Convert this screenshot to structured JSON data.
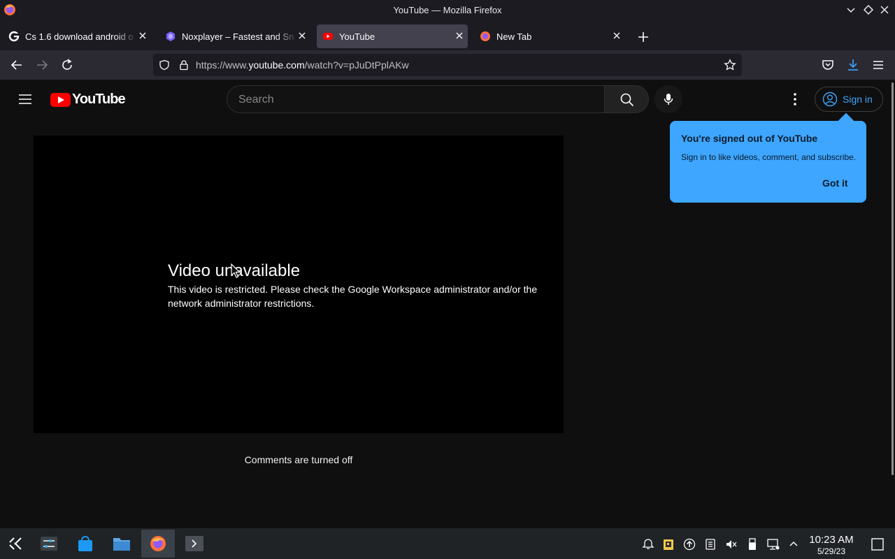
{
  "window": {
    "title": "YouTube — Mozilla Firefox"
  },
  "tabs": [
    {
      "label": "Cs 1.6 download android o",
      "icon": "google-g-icon",
      "active": false
    },
    {
      "label": "Noxplayer – Fastest and Sn",
      "icon": "noxplayer-icon",
      "active": false
    },
    {
      "label": "YouTube",
      "icon": "youtube-icon",
      "active": true
    },
    {
      "label": "New Tab",
      "icon": "firefox-icon",
      "active": false
    }
  ],
  "urlbar": {
    "prefix": "https://www.",
    "domain": "youtube.com",
    "path": "/watch?v=pJuDtPplAKw"
  },
  "youtube": {
    "logo_text": "YouTube",
    "search_placeholder": "Search",
    "signin_label": "Sign in"
  },
  "popup": {
    "heading": "You're signed out of YouTube",
    "body": "Sign in to like videos, comment, and subscribe.",
    "button": "Got it"
  },
  "player": {
    "heading": "Video unavailable",
    "message": "This video is restricted. Please check the Google Workspace administrator and/or the network administrator restrictions."
  },
  "comments": {
    "status": "Comments are turned off"
  },
  "taskbar": {
    "clock_time": "10:23 AM",
    "clock_date": "5/29/23"
  },
  "colors": {
    "youtube_red": "#ff0000",
    "accent_blue": "#3ea6ff",
    "page_bg": "#0f0f0f",
    "firefox_toolbar": "#2b2a33"
  }
}
